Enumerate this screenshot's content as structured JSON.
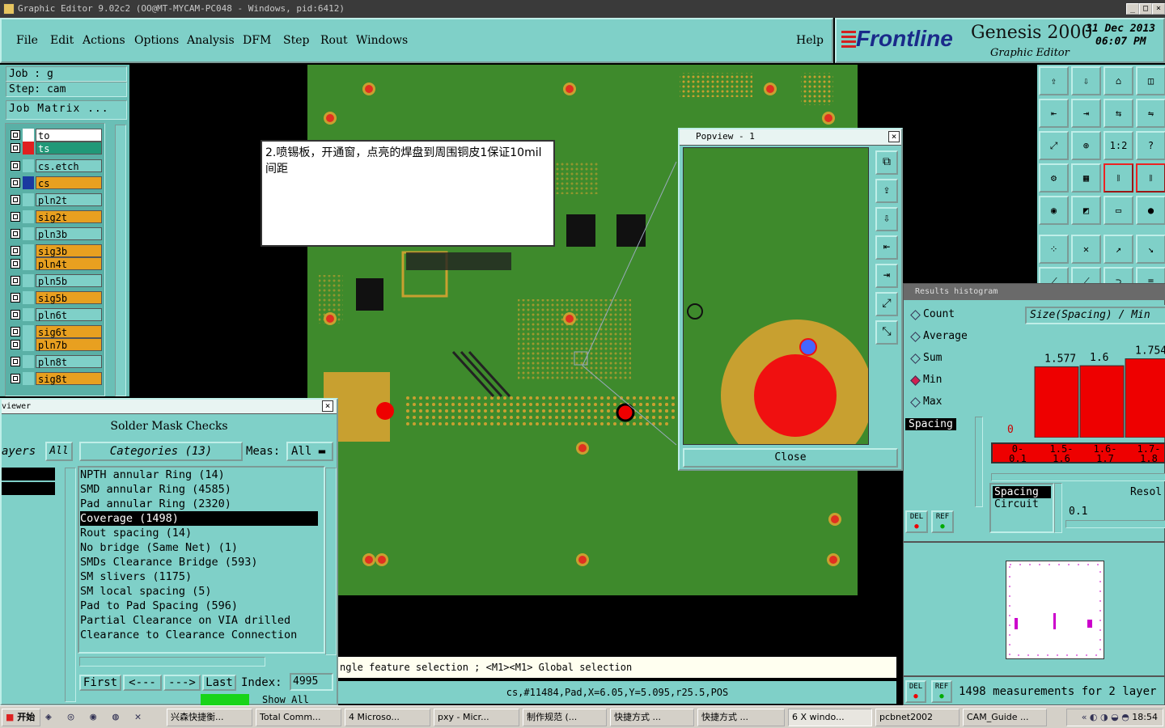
{
  "window": {
    "title": "Graphic Editor 9.02c2 (OO@MT-MYCAM-PC048 - Windows, pid:6412)"
  },
  "menu": {
    "items": [
      "File",
      "Edit",
      "Actions",
      "Options",
      "Analysis",
      "DFM",
      "Step",
      "Rout",
      "Windows"
    ],
    "help": "Help"
  },
  "brand": {
    "logo": "Frontline",
    "product": "Genesis 2000",
    "sub": "Graphic Editor",
    "date": "31 Dec 2013",
    "time": "06:07 PM"
  },
  "job": {
    "job": "Job : g",
    "step": "Step: cam",
    "matrix": "Job Matrix ..."
  },
  "layers": [
    "to",
    "ts",
    "cs.etch",
    "cs",
    "pln2t",
    "sig2t",
    "pln3b",
    "sig3b",
    "pln4t",
    "pln5b",
    "sig5b",
    "pln6t",
    "sig6t",
    "pln7b",
    "pln8t",
    "sig8t"
  ],
  "note": {
    "text": "2.喷锡板，开通窗，点亮的焊盘到周围铜皮1保证10mil间距"
  },
  "popview": {
    "title": "Popview - 1",
    "close": "Close"
  },
  "viewer": {
    "title": "viewer",
    "heading": "Solder Mask Checks",
    "layers_label": "ayers",
    "all": "All",
    "categories": "Categories (13)",
    "meas_label": "Meas:",
    "meas_value": "All",
    "items": [
      "NPTH annular Ring (14)",
      "SMD annular Ring (4585)",
      "Pad annular Ring (2320)",
      "Coverage (1498)",
      "Rout spacing (14)",
      "No bridge (Same Net) (1)",
      "SMDs Clearance Bridge (593)",
      "SM slivers (1175)",
      "SM local spacing (5)",
      "Pad to Pad Spacing (596)",
      "Partial Clearance on VIA drilled",
      "Clearance to Clearance Connection"
    ],
    "first": "First",
    "prev": "<---",
    "next": "--->",
    "last": "Last",
    "index_label": "Index:",
    "index_value": "4995",
    "show_all": "Show All"
  },
  "status": {
    "message": "ngle feature selection ; <M1><M1> Global selection",
    "coords": "cs,#11484,Pad,X=6.05,Y=5.095,r25.5,POS"
  },
  "histogram": {
    "title": "Results histogram",
    "modes": [
      "Count",
      "Average",
      "Sum",
      "Min",
      "Max"
    ],
    "selected": "Min",
    "axis_title": "Size(Spacing) / Min",
    "values": [
      "0",
      "1.577",
      "1.6",
      "1.754"
    ],
    "bins": [
      "0-\n0.1",
      "1.5-\n1.6",
      "1.6-\n1.7",
      "1.7-\n1.8"
    ],
    "list": [
      "Spacing",
      "Circuit"
    ],
    "list_top": "Spacing",
    "resol_label": "Resol",
    "resol_value": "0.1",
    "del": "DEL",
    "ref": "REF",
    "measure_text": "1498 measurements for 2 layer"
  },
  "taskbar": {
    "start": "开始",
    "tasks": [
      "兴森快捷衡...",
      "Total Comm...",
      "4 Microso...",
      "pxy - Micr...",
      "制作规范 (...",
      "快捷方式 ...",
      "快捷方式 ...",
      "6 X windo...",
      "pcbnet2002",
      "CAM_Guide ..."
    ],
    "clock": "18:54"
  },
  "colors": {
    "teal": "#7fd0c8",
    "board": "#3e8a2c",
    "pad": "#e03020",
    "ring": "#c8a030",
    "brand_red": "#d42020",
    "brand_blue": "#1a2a8a"
  }
}
